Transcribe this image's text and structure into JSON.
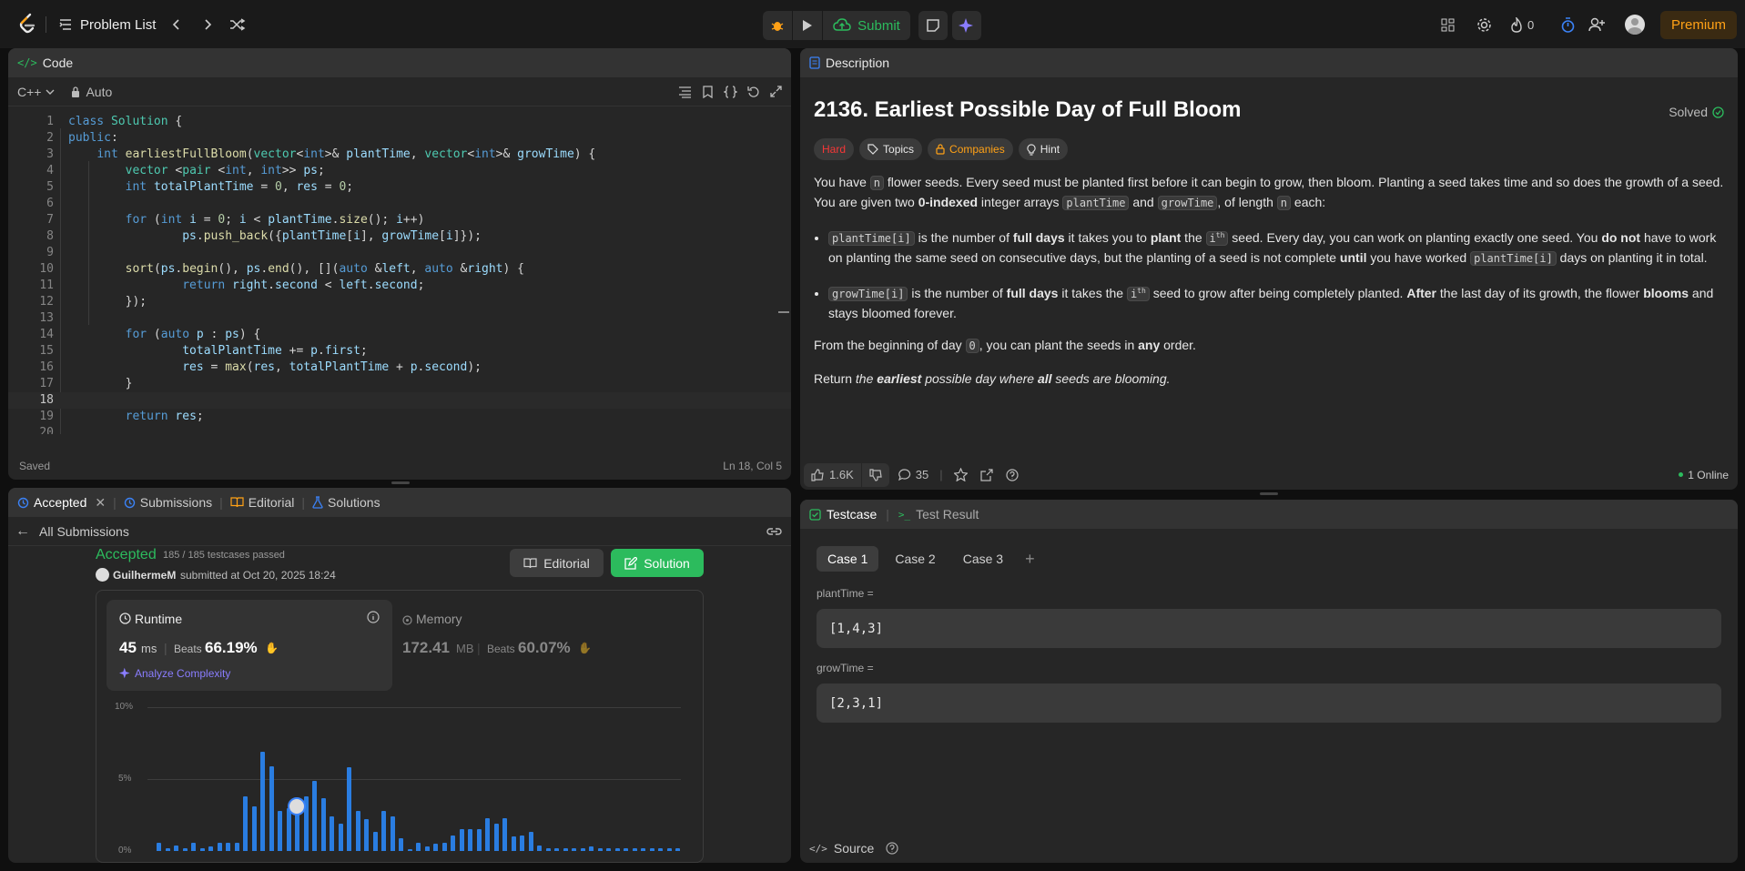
{
  "nav": {
    "problem_list": "Problem List",
    "submit": "Submit",
    "streak": "0",
    "premium": "Premium"
  },
  "code": {
    "tab": "Code",
    "language": "C++",
    "auto": "Auto",
    "status_saved": "Saved",
    "cursor": "Ln 18, Col 5",
    "lines": [
      {
        "n": "1"
      },
      {
        "n": "2"
      },
      {
        "n": "3"
      },
      {
        "n": "4"
      },
      {
        "n": "5"
      },
      {
        "n": "6"
      },
      {
        "n": "7"
      },
      {
        "n": "8"
      },
      {
        "n": "9"
      },
      {
        "n": "10"
      },
      {
        "n": "11"
      },
      {
        "n": "12"
      },
      {
        "n": "13"
      },
      {
        "n": "14"
      },
      {
        "n": "15"
      },
      {
        "n": "16"
      },
      {
        "n": "17"
      },
      {
        "n": "18"
      },
      {
        "n": "19"
      },
      {
        "n": "20"
      }
    ],
    "text": [
      "class Solution {",
      "public:",
      "    int earliestFullBloom(vector<int>& plantTime, vector<int>& growTime) {",
      "        vector <pair <int, int>> ps;",
      "        int totalPlantTime = 0, res = 0;",
      "",
      "        for (int i = 0; i < plantTime.size(); i++)",
      "                ps.push_back({plantTime[i], growTime[i]});",
      "",
      "        sort(ps.begin(), ps.end(), [](auto &left, auto &right) {",
      "                return right.second < left.second;",
      "        });",
      "",
      "        for (auto p : ps) {",
      "                totalPlantTime += p.first;",
      "                res = max(res, totalPlantTime + p.second);",
      "        }",
      "",
      "        return res;",
      ""
    ]
  },
  "description": {
    "tab": "Description",
    "title": "2136. Earliest Possible Day of Full Bloom",
    "solved": "Solved",
    "tags": {
      "difficulty": "Hard",
      "topics": "Topics",
      "companies": "Companies",
      "hint": "Hint"
    },
    "p1a": "You have ",
    "p1_n": "n",
    "p1b": " flower seeds. Every seed must be planted first before it can begin to grow, then bloom. Planting a seed takes time and so does the growth of a seed. You are given two ",
    "p1_bold": "0-indexed",
    "p1c": " integer arrays ",
    "p1_code1": "plantTime",
    "p1d": " and ",
    "p1_code2": "growTime",
    "p1e": ", of length ",
    "p1_n2": "n",
    "p1f": " each:",
    "b1_code": "plantTime[i]",
    "b1a": " is the number of ",
    "b1_bold1": "full days",
    "b1b": " it takes you to ",
    "b1_bold2": "plant",
    "b1c": " the ",
    "b1_ith": "i",
    "b1_sup": "th",
    "b1d": " seed. Every day, you can work on planting exactly one seed. You ",
    "b1_bold3": "do not",
    "b1e": " have to work on planting the same seed on consecutive days, but the planting of a seed is not complete ",
    "b1_bold4": "until",
    "b1f": " you have worked ",
    "b1_code2": "plantTime[i]",
    "b1g": " days on planting it in total.",
    "b2_code": "growTime[i]",
    "b2a": " is the number of ",
    "b2_bold1": "full days",
    "b2b": " it takes the ",
    "b2_ith": "i",
    "b2_sup": "th",
    "b2c": " seed to grow after being completely planted. ",
    "b2_bold2": "After",
    "b2d": " the last day of its growth, the flower ",
    "b2_bold3": "blooms",
    "b2e": " and stays bloomed forever.",
    "p2a": "From the beginning of day ",
    "p2_code": "0",
    "p2b": ", you can plant the seeds in ",
    "p2_bold": "any",
    "p2c": " order.",
    "p3a": "Return ",
    "p3_i1": "the ",
    "p3_bold1": "earliest",
    "p3_i2": " possible day where ",
    "p3_bold2": "all",
    "p3_i3": " seeds are blooming.",
    "likes": "1.6K",
    "comments": "35",
    "online": "1 Online"
  },
  "submission": {
    "tab_accepted": "Accepted",
    "tab_submissions": "Submissions",
    "tab_editorial": "Editorial",
    "tab_solutions": "Solutions",
    "all_submissions": "All Submissions",
    "status": "Accepted",
    "passed": "185 / 185 testcases passed",
    "user": "GuilhermeM",
    "submitted": "submitted at Oct 20, 2025 18:24",
    "btn_editorial": "Editorial",
    "btn_solution": "Solution",
    "runtime_label": "Runtime",
    "runtime_value": "45",
    "runtime_unit": "ms",
    "beats": "Beats",
    "runtime_beats": "66.19%",
    "analyze": "Analyze Complexity",
    "memory_label": "Memory",
    "memory_value": "172.41",
    "memory_unit": "MB",
    "memory_beats": "60.07%"
  },
  "chart_data": {
    "type": "bar",
    "ylabels": [
      "10%",
      "5%",
      "0%"
    ],
    "ylim": [
      0,
      10
    ],
    "values": [
      0.6,
      0.2,
      0.4,
      0.2,
      0.6,
      0.2,
      0.3,
      0.6,
      0.6,
      0.6,
      3.8,
      3.1,
      6.9,
      5.9,
      2.8,
      3.0,
      3.1,
      3.8,
      4.9,
      3.7,
      2.4,
      1.9,
      5.8,
      2.8,
      2.2,
      1.3,
      2.8,
      2.4,
      0.9,
      0.1,
      0.6,
      0.3,
      0.5,
      0.6,
      1.1,
      1.5,
      1.5,
      1.5,
      2.3,
      1.9,
      2.3,
      1.0,
      1.1,
      1.3,
      0.4,
      0.2,
      0.2,
      0.2,
      0.2,
      0.2,
      0.3,
      0.2,
      0.2,
      0.2,
      0.2,
      0.2,
      0.2,
      0.2,
      0.2,
      0.2,
      0.2
    ],
    "highlight_index": 16
  },
  "testcase": {
    "tab": "Testcase",
    "result_tab": "Test Result",
    "cases": [
      "Case 1",
      "Case 2",
      "Case 3"
    ],
    "label1": "plantTime =",
    "value1": "[1,4,3]",
    "label2": "growTime =",
    "value2": "[2,3,1]",
    "source": "Source"
  }
}
